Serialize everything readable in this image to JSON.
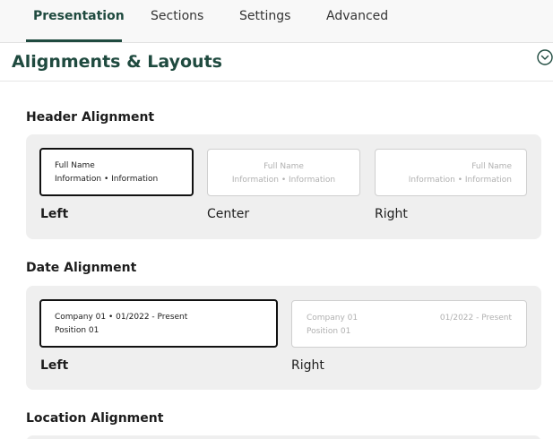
{
  "tabs": [
    {
      "label": "Presentation",
      "active": true
    },
    {
      "label": "Sections",
      "active": false
    },
    {
      "label": "Settings",
      "active": false
    },
    {
      "label": "Advanced",
      "active": false
    }
  ],
  "section": {
    "title": "Alignments & Layouts",
    "collapse_icon": "chevron-down-circle-icon"
  },
  "header_alignment": {
    "label": "Header Alignment",
    "options": [
      {
        "label": "Left",
        "line1": "Full Name",
        "line2": "Information • Information",
        "selected": true
      },
      {
        "label": "Center",
        "line1": "Full Name",
        "line2": "Information • Information",
        "selected": false
      },
      {
        "label": "Right",
        "line1": "Full Name",
        "line2": "Information • Information",
        "selected": false
      }
    ]
  },
  "date_alignment": {
    "label": "Date Alignment",
    "options": [
      {
        "label": "Left",
        "line1": "Company 01 • 01/2022 - Present",
        "line2": "Position 01",
        "selected": true
      },
      {
        "label": "Right",
        "line1_left": "Company 01",
        "line1_right": "01/2022 - Present",
        "line2": "Position 01",
        "selected": false
      }
    ]
  },
  "location_alignment": {
    "label": "Location Alignment"
  },
  "colors": {
    "accent": "#1f4a3f",
    "panel_bg": "#efefef",
    "selected_border": "#111111"
  }
}
